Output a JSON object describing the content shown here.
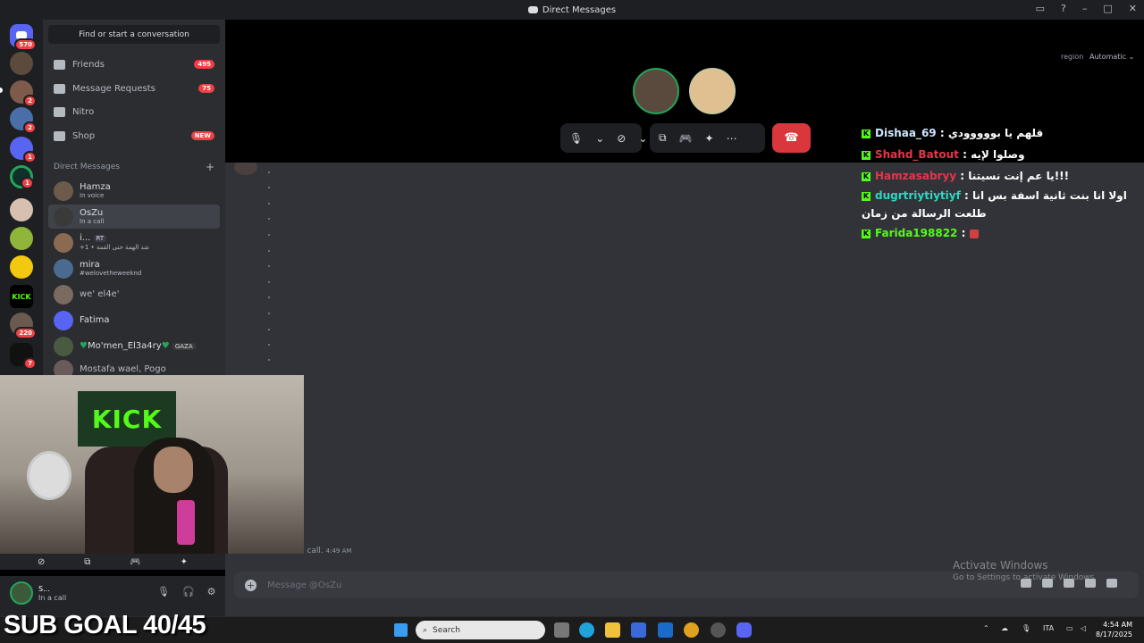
{
  "window": {
    "title": "Direct Messages"
  },
  "servers": [
    {
      "badge": "570"
    },
    {
      "badge": ""
    },
    {
      "badge": "2"
    },
    {
      "badge": "2"
    },
    {
      "badge": "1"
    },
    {
      "badge": "1"
    },
    {
      "badge": ""
    },
    {
      "badge": ""
    },
    {
      "badge": ""
    },
    {
      "badge": "220"
    },
    {
      "badge": "7"
    }
  ],
  "sidebar": {
    "find_label": "Find or start a conversation",
    "nav": [
      {
        "label": "Friends",
        "badge": "495"
      },
      {
        "label": "Message Requests",
        "badge": "75"
      },
      {
        "label": "Nitro",
        "badge": ""
      },
      {
        "label": "Shop",
        "badge": "NEW"
      }
    ],
    "dm_header": "Direct Messages",
    "dms": [
      {
        "name": "Hamza",
        "status": "In voice"
      },
      {
        "name": "OsZu",
        "status": "In a call"
      },
      {
        "name": "i...",
        "status": "+1 • شد الهمة حتى القمة",
        "tag": "RT"
      },
      {
        "name": "mira",
        "status": "#welovetheweeknd"
      },
      {
        "name": "we' el4e'",
        "status": ""
      },
      {
        "name": "Fatima",
        "status": ""
      },
      {
        "name": "Mo'men_El3a4ry",
        "status": "",
        "tag": "GAZA"
      },
      {
        "name": "Mostafa wael, Pogo",
        "status": ""
      }
    ]
  },
  "call": {
    "region_label": "region",
    "region_value": "Automatic"
  },
  "kick_chat": [
    {
      "user": "Dishaa_69",
      "color": "#cfe6ff",
      "msg": "قلهم يا بووووودي"
    },
    {
      "user": "Shahd_Batout",
      "color": "#e8344a",
      "msg": "وصلوا لإيه"
    },
    {
      "user": "Hamzasabryy",
      "color": "#e8344a",
      "msg": "يا عم إنت نسيتنا!!!"
    },
    {
      "user": "dugrtriytiytiyf",
      "color": "#2fd6c2",
      "msg": "اولا انا بنت ثانية اسفة بس انا طلعت الرسالة من زمان"
    },
    {
      "user": "Farida198822",
      "color": "#53fc18",
      "msg": ""
    }
  ],
  "main": {
    "call_message": "started a call.",
    "call_time": "4:49 AM",
    "message_placeholder": "Message @OsZu"
  },
  "webcam": {
    "flag_text": "KICK"
  },
  "user_panel": {
    "name": "S...",
    "status": "In a call"
  },
  "watermark": {
    "line1": "Activate Windows",
    "line2": "Go to Settings to activate Windows."
  },
  "overlay": {
    "sub_goal": "SUB GOAL 40/45"
  },
  "taskbar": {
    "search_placeholder": "Search",
    "lang": "ITA",
    "time": "4:54 AM",
    "date": "8/17/2025"
  }
}
